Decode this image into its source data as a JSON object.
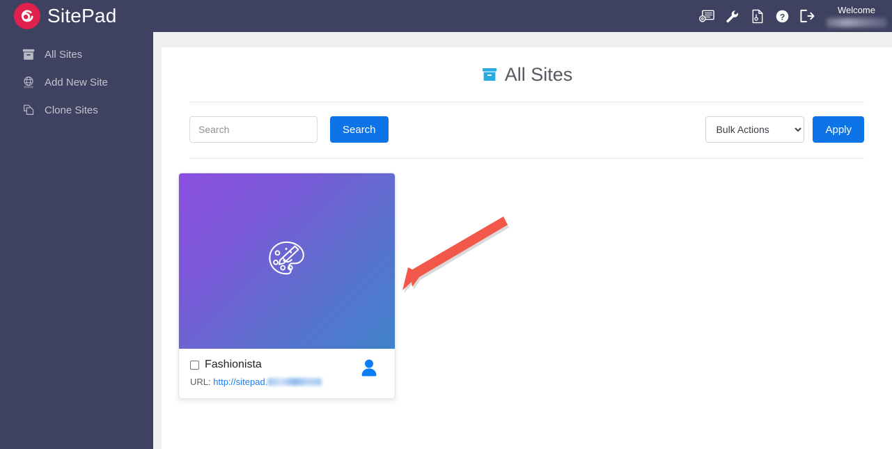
{
  "brand": {
    "name": "SitePad",
    "logo_icon": "sitepad-spiral-logo",
    "logo_color": "#e0214d"
  },
  "sidebar": {
    "background": "#3e4160",
    "items": [
      {
        "label": "All Sites",
        "icon": "archive-box-icon"
      },
      {
        "label": "Add New Site",
        "icon": "globe-www-icon"
      },
      {
        "label": "Clone Sites",
        "icon": "copy-pages-icon"
      }
    ]
  },
  "topbar": {
    "icons": [
      {
        "name": "license-settings-icon"
      },
      {
        "name": "wrench-icon"
      },
      {
        "name": "file-document-icon"
      },
      {
        "name": "help-question-icon"
      },
      {
        "name": "logout-icon"
      }
    ],
    "welcome_label": "Welcome",
    "welcome_user": ""
  },
  "page": {
    "title": "All Sites",
    "title_icon": "archive-box-icon",
    "title_icon_color": "#29abe2"
  },
  "toolbar": {
    "search_placeholder": "Search",
    "search_value": "",
    "search_button": "Search",
    "bulk_selected": "Bulk Actions",
    "bulk_options": [
      "Bulk Actions"
    ],
    "apply_button": "Apply",
    "button_color": "#0d74e7"
  },
  "sites": [
    {
      "name": "Fashionista",
      "checked": false,
      "url_label": "URL:",
      "url_visible": "http://sitepad.",
      "thumb_icon": "paint-palette-icon",
      "thumb_gradient_from": "#8b4fe0",
      "thumb_gradient_to": "#3f82cb",
      "user_icon": "user-person-icon",
      "user_icon_color": "#0a7ff5"
    }
  ],
  "annotation": {
    "type": "arrow",
    "color": "#f2584a",
    "points_to": "site-card-thumbnail"
  }
}
